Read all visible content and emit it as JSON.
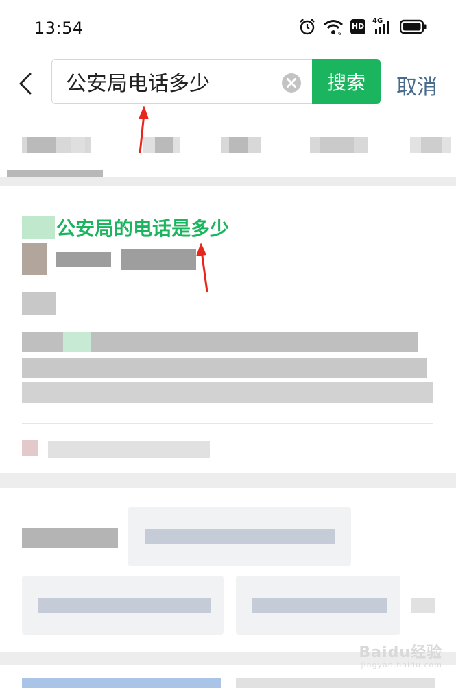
{
  "status_bar": {
    "time": "13:54",
    "icons": [
      "alarm-icon",
      "wifi-icon",
      "hd-icon",
      "signal-4g-icon",
      "battery-icon"
    ],
    "hd_label": "HD",
    "network_label": "4G"
  },
  "search": {
    "query": "公安局电话多少",
    "button_label": "搜索",
    "cancel_label": "取消"
  },
  "result": {
    "title": "公安局的电话是多少"
  },
  "watermark": {
    "brand": "Baidu经验",
    "url": "jingyan.baidu.com"
  },
  "colors": {
    "accent_green": "#1cb55f",
    "cancel_blue": "#4a6a8c",
    "annotation_red": "#e8261c"
  }
}
